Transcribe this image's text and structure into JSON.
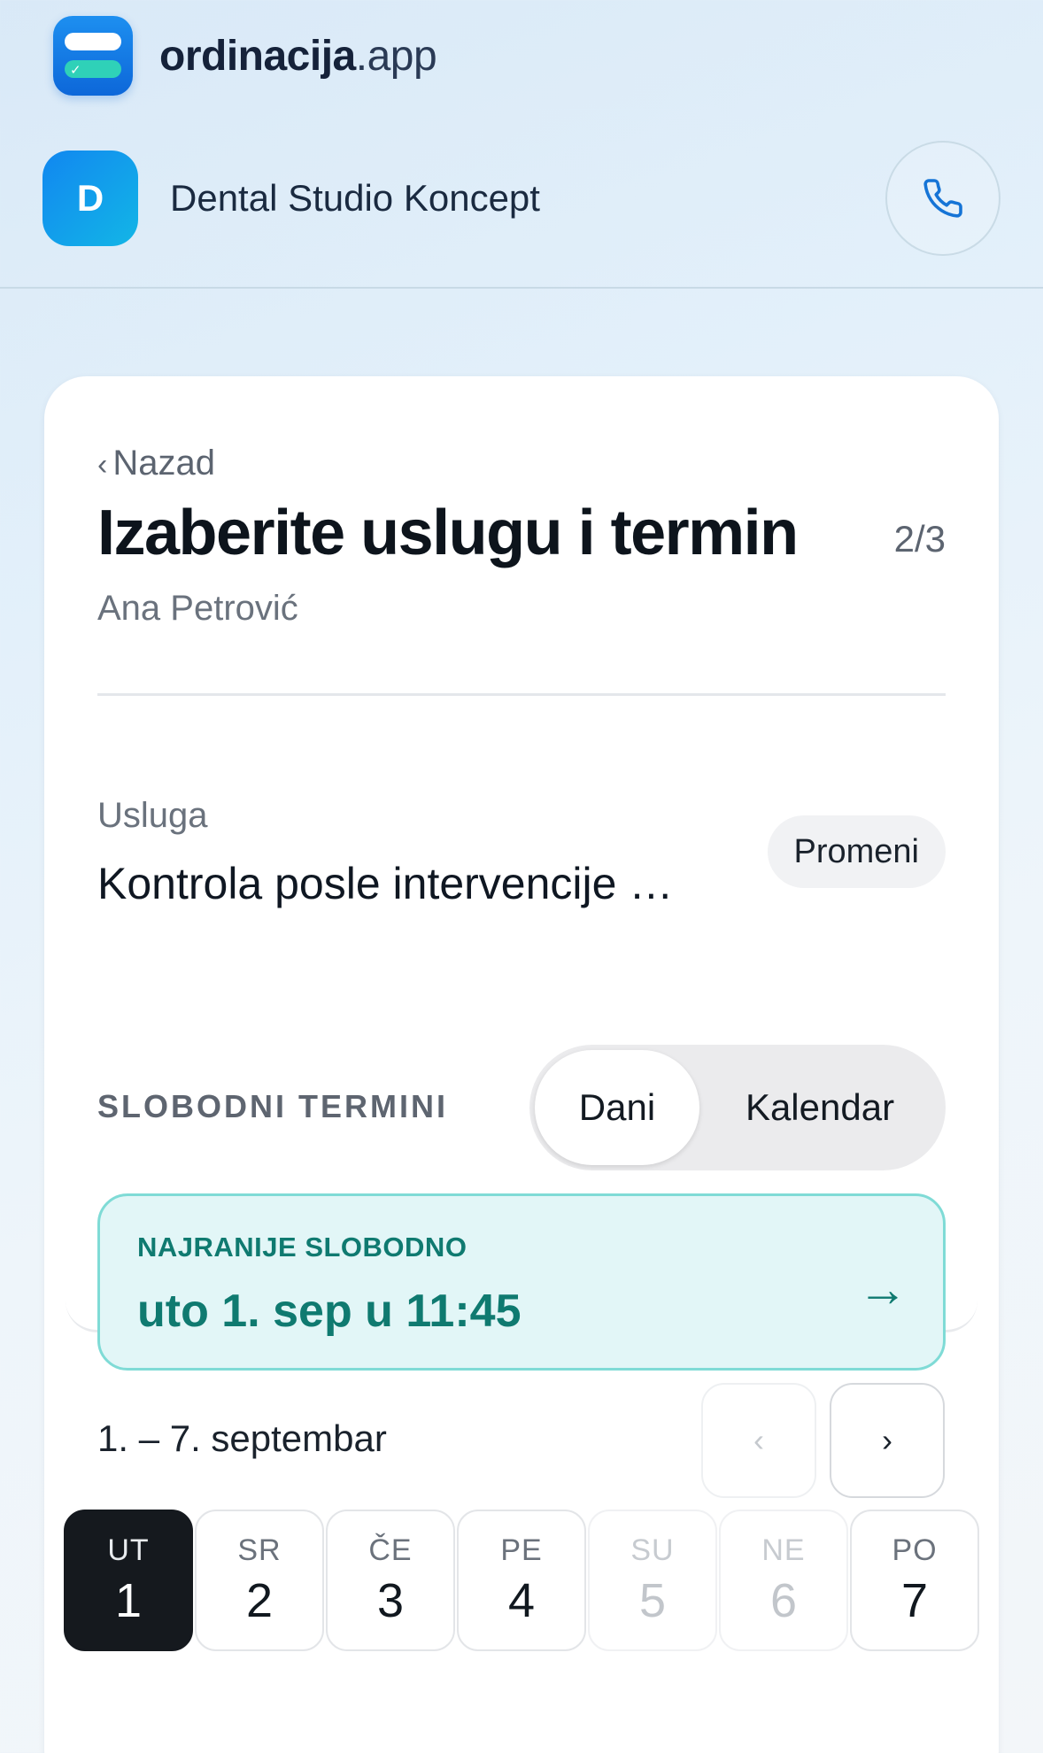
{
  "brand": {
    "name_bold": "ordinacija",
    "name_light": ".app"
  },
  "clinic": {
    "initial": "D",
    "name": "Dental Studio Koncept"
  },
  "header": {
    "back_label": "Nazad",
    "title": "Izaberite uslugu i termin",
    "step": "2/3",
    "patient": "Ana Petrović"
  },
  "service": {
    "label": "Usluga",
    "value": "Kontrola posle intervencije …",
    "change_label": "Promeni"
  },
  "slots": {
    "label": "SLOBODNI TERMINI",
    "view_toggle": [
      {
        "label": "Dani",
        "active": true
      },
      {
        "label": "Kalendar",
        "active": false
      }
    ]
  },
  "earliest": {
    "label": "NAJRANIJE SLOBODNO",
    "value": "uto 1. sep u 11:45",
    "arrow": "→"
  },
  "week": {
    "range": "1. – 7. septembar",
    "prev": "‹",
    "next": "›",
    "days": [
      {
        "dow": "UT",
        "num": "1",
        "state": "selected"
      },
      {
        "dow": "SR",
        "num": "2",
        "state": "available"
      },
      {
        "dow": "ČE",
        "num": "3",
        "state": "available"
      },
      {
        "dow": "PE",
        "num": "4",
        "state": "available"
      },
      {
        "dow": "SU",
        "num": "5",
        "state": "disabled"
      },
      {
        "dow": "NE",
        "num": "6",
        "state": "disabled"
      },
      {
        "dow": "PO",
        "num": "7",
        "state": "available"
      }
    ]
  },
  "colors": {
    "accent_teal": "#0f7a70",
    "brand_blue": "#0d67d9",
    "selected_day": "#15191e"
  }
}
